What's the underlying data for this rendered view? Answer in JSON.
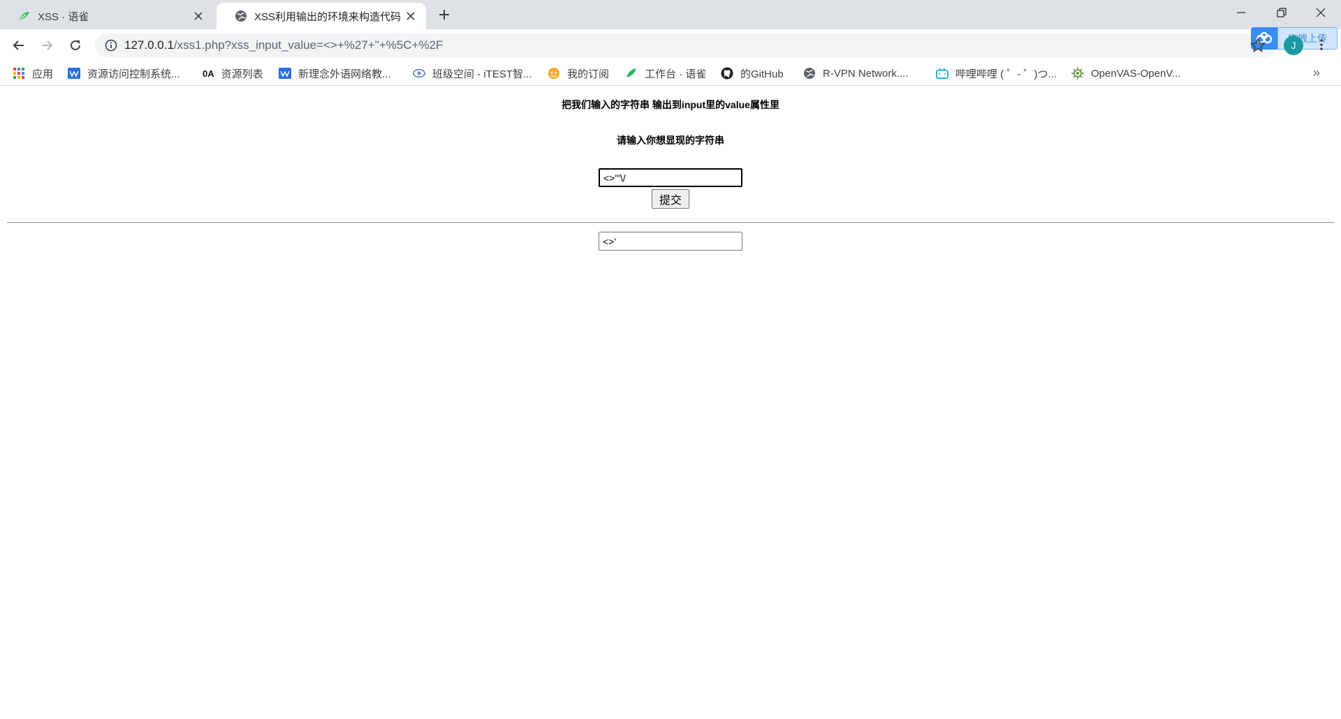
{
  "tabs": [
    {
      "title": "XSS · 语雀",
      "icon": "yuque-leaf-icon",
      "active": false
    },
    {
      "title": "XSS利用输出的环境来构造代码",
      "icon": "globe-icon",
      "active": true
    }
  ],
  "address_bar": {
    "host": "127.0.0.1",
    "path": "/xss1.php?xss_input_value=<>+%27+\"+%5C+%2F"
  },
  "extension": {
    "label": "拖拽上传",
    "icon": "baidu-cloud-icon"
  },
  "profile": {
    "initial": "J",
    "color": "#1a9aa0"
  },
  "bookmarks": [
    {
      "label": "应用",
      "icon": "apps-grid-icon"
    },
    {
      "label": "资源访问控制系统...",
      "icon": "site-logo-icon"
    },
    {
      "label": "资源列表",
      "icon": "oa-logo-icon",
      "icon_text": "0A"
    },
    {
      "label": "新理念外语网络教...",
      "icon": "site-logo-icon"
    },
    {
      "label": "班级空间 - iTEST智...",
      "icon": "itest-logo-icon"
    },
    {
      "label": "我的订阅",
      "icon": "subscribe-icon"
    },
    {
      "label": "工作台 · 语雀",
      "icon": "yuque-leaf-icon"
    },
    {
      "label": "的GitHub",
      "icon": "github-icon"
    },
    {
      "label": "R-VPN Network....",
      "icon": "globe-icon"
    },
    {
      "label": "哔哩哔哩 ( ゜- ゜)つ...",
      "icon": "bilibili-icon"
    },
    {
      "label": "OpenVAS-OpenV...",
      "icon": "openvas-icon"
    }
  ],
  "bookmarks_more": "»",
  "page": {
    "heading1": "把我们输入的字符串 输出到input里的value属性里",
    "heading2": "请输入你想显现的字符串",
    "input_value": "<>'\"\\/",
    "submit_label": "提交",
    "output_value": "<>'"
  }
}
